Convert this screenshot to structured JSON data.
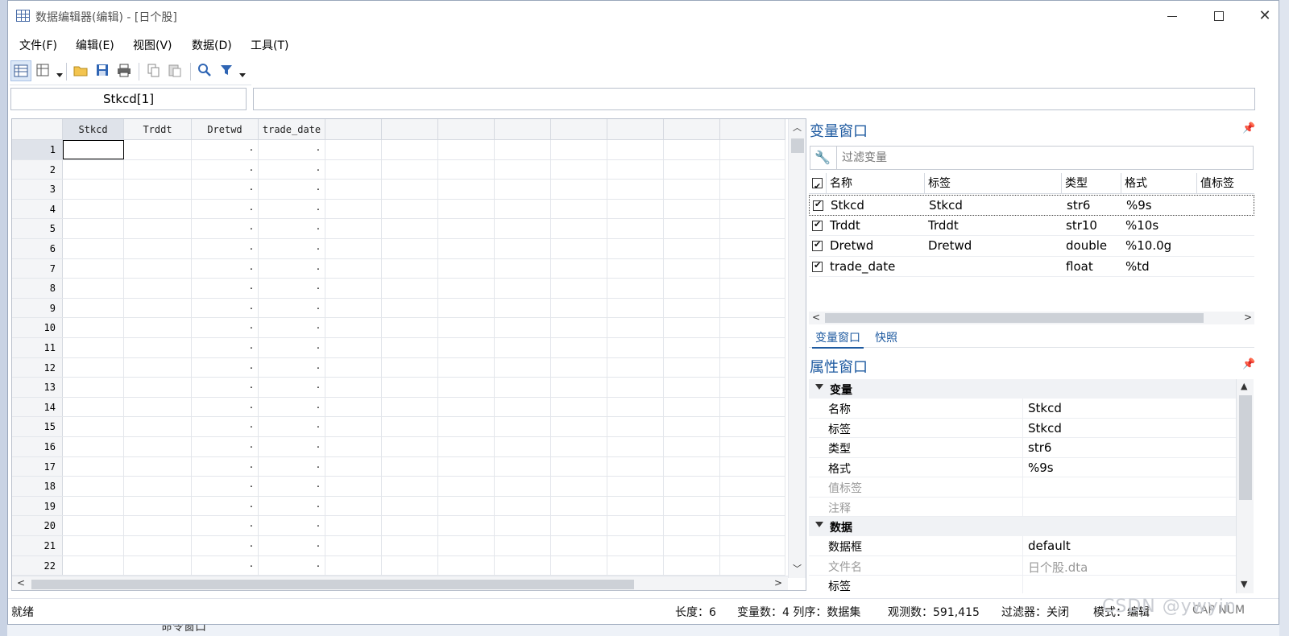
{
  "window": {
    "title": "数据编辑器(编辑) - [日个股]"
  },
  "background": {
    "behind_text": "命令窗口"
  },
  "menu": [
    "文件(F)",
    "编辑(E)",
    "视图(V)",
    "数据(D)",
    "工具(T)"
  ],
  "varbox": {
    "value": "Stkcd[1]"
  },
  "grid": {
    "columns": [
      "Stkcd",
      "Trddt",
      "Dretwd",
      "trade_date"
    ],
    "row_numbers": [
      "1",
      "2",
      "3",
      "4",
      "5",
      "6",
      "7",
      "8",
      "9",
      "10",
      "11",
      "12",
      "13",
      "14",
      "15",
      "16",
      "17",
      "18",
      "19",
      "20",
      "21",
      "22"
    ],
    "missing_mark": "."
  },
  "variables_panel": {
    "title": "变量窗口",
    "filter_placeholder": "过滤变量",
    "headers": {
      "name": "名称",
      "label": "标签",
      "type": "类型",
      "format": "格式",
      "value_label": "值标签"
    },
    "rows": [
      {
        "name": "Stkcd",
        "label": "Stkcd",
        "type": "str6",
        "format": "%9s"
      },
      {
        "name": "Trddt",
        "label": "Trddt",
        "type": "str10",
        "format": "%10s"
      },
      {
        "name": "Dretwd",
        "label": "Dretwd",
        "type": "double",
        "format": "%10.0g"
      },
      {
        "name": "trade_date",
        "label": "",
        "type": "float",
        "format": "%td"
      }
    ],
    "tabs": [
      "变量窗口",
      "快照"
    ]
  },
  "properties_panel": {
    "title": "属性窗口",
    "section_variable": "变量",
    "section_data": "数据",
    "variable_rows": [
      {
        "key": "名称",
        "value": "Stkcd"
      },
      {
        "key": "标签",
        "value": "Stkcd"
      },
      {
        "key": "类型",
        "value": "str6"
      },
      {
        "key": "格式",
        "value": "%9s"
      },
      {
        "key": "值标签",
        "value": ""
      },
      {
        "key": "注释",
        "value": ""
      }
    ],
    "data_rows": [
      {
        "key": "数据框",
        "value": "default"
      },
      {
        "key": "文件名",
        "value": "日个股.dta"
      },
      {
        "key": "标签",
        "value": ""
      }
    ]
  },
  "status": {
    "ready": "就绪",
    "length": "长度：6",
    "var_count": "变量数：4 列序：数据集",
    "obs": "观测数：591,415",
    "filter": "过滤器：关闭",
    "mode": "模式：编辑",
    "caps": "CAP NUM"
  },
  "watermark": "CSDN @ywyin"
}
